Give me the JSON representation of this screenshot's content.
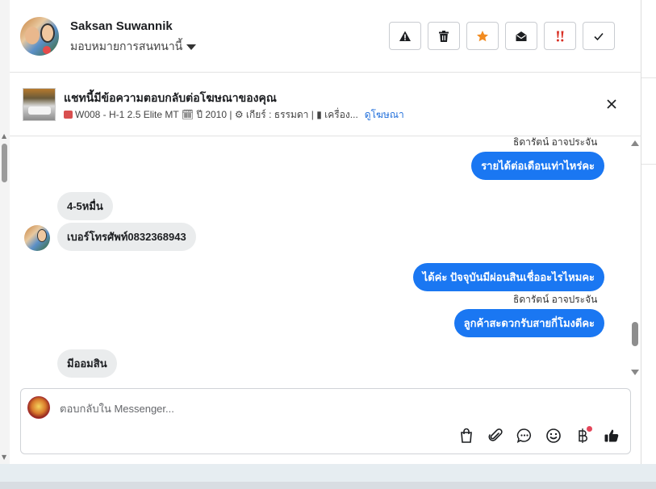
{
  "header": {
    "user_name": "Saksan Suwannik",
    "assign_label": "มอบหมายการสนทนานี้",
    "toolbar": [
      "report-spam",
      "delete",
      "star",
      "mark-unread",
      "follow-up",
      "mark-done"
    ]
  },
  "ad": {
    "title": "แชทนี้มีข้อความตอบกลับต่อโฆษณาของคุณ",
    "detail": "W008 - H-1 2.5 Elite MT 🗓 ปี 2010 | ⚙ เกียร์ : ธรรมดา | ▮ เครื่อง...",
    "link": "ดูโฆษณา"
  },
  "messages": {
    "m1_sender": "ธิดารัตน์ อาจประจัน",
    "m1_text": "รายได้ต่อเดือนเท่าไหร่คะ",
    "m2_text": "4-5หมื่น",
    "m3_text": "เบอร์โทรศัพท์0832368943",
    "m4_text": "ได้ค่ะ ปัจจุบันมีผ่อนสินเชื่ออะไรไหมคะ",
    "m5_sender": "ธิดารัตน์ อาจประจัน",
    "m5_text": "ลูกค้าสะดวกรับสายกี่โมงดีคะ",
    "m6_text": "มีออมสิน"
  },
  "composer": {
    "placeholder": "ตอบกลับใน Messenger..."
  },
  "colors": {
    "outgoing_bubble": "#1a77f2",
    "incoming_bubble": "#eaeced",
    "star": "#f28b20",
    "follow_up": "#d93025",
    "link": "#216fdb"
  }
}
